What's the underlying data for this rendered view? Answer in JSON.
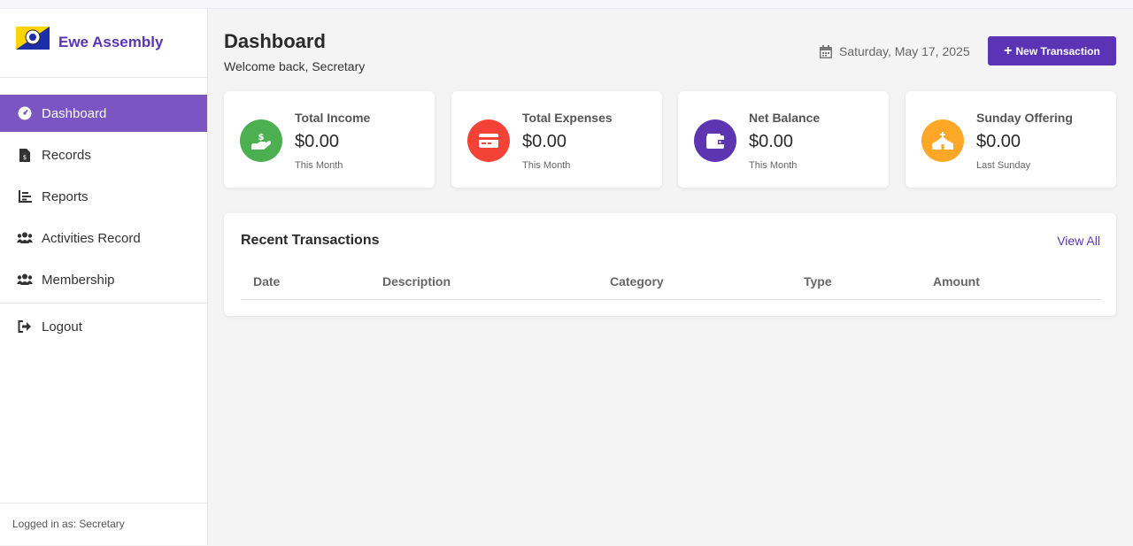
{
  "brand": {
    "name": "Ewe Assembly"
  },
  "nav": {
    "items": [
      {
        "label": "Dashboard",
        "icon": "dashboard-icon",
        "active": true
      },
      {
        "label": "Records",
        "icon": "file-invoice-icon"
      },
      {
        "label": "Reports",
        "icon": "chart-icon"
      },
      {
        "label": "Activities Record",
        "icon": "users-icon"
      },
      {
        "label": "Membership",
        "icon": "users-icon"
      }
    ],
    "logout": {
      "label": "Logout",
      "icon": "logout-icon"
    }
  },
  "footer": {
    "logged_in": "Logged in as: Secretary"
  },
  "header": {
    "title": "Dashboard",
    "subtitle": "Welcome back, Secretary",
    "date": "Saturday, May 17, 2025",
    "new_transaction": "New Transaction"
  },
  "cards": [
    {
      "label": "Total Income",
      "value": "$0.00",
      "period": "This Month",
      "color": "#4caf50",
      "icon": "hand-dollar-icon"
    },
    {
      "label": "Total Expenses",
      "value": "$0.00",
      "period": "This Month",
      "color": "#f44336",
      "icon": "credit-card-icon"
    },
    {
      "label": "Net Balance",
      "value": "$0.00",
      "period": "This Month",
      "color": "#5e35b1",
      "icon": "wallet-icon"
    },
    {
      "label": "Sunday Offering",
      "value": "$0.00",
      "period": "Last Sunday",
      "color": "#ffa726",
      "icon": "church-icon"
    }
  ],
  "transactions": {
    "title": "Recent Transactions",
    "view_all": "View All",
    "columns": [
      "Date",
      "Description",
      "Category",
      "Type",
      "Amount"
    ],
    "rows": []
  },
  "colors": {
    "accent": "#5b34b6",
    "active_nav": "#7b55c2"
  }
}
